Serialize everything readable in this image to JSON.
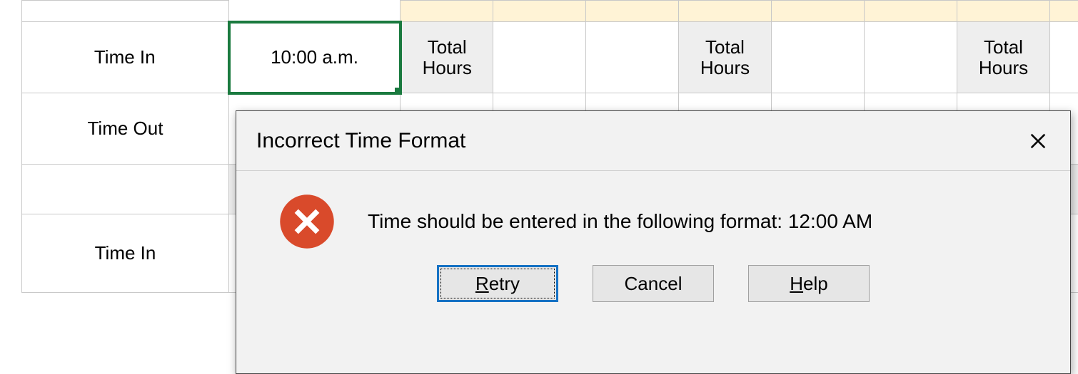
{
  "grid": {
    "row_time_in": "Time In",
    "row_time_out": "Time Out",
    "row_time_in2": "Time In",
    "selected_value": "10:00 a.m.",
    "total_hours": "Total Hours"
  },
  "dialog": {
    "title": "Incorrect Time Format",
    "icon": "error-icon",
    "message": "Time should be entered in the following format: 12:00 AM",
    "buttons": {
      "retry": "Retry",
      "cancel": "Cancel",
      "help": "Help"
    }
  }
}
